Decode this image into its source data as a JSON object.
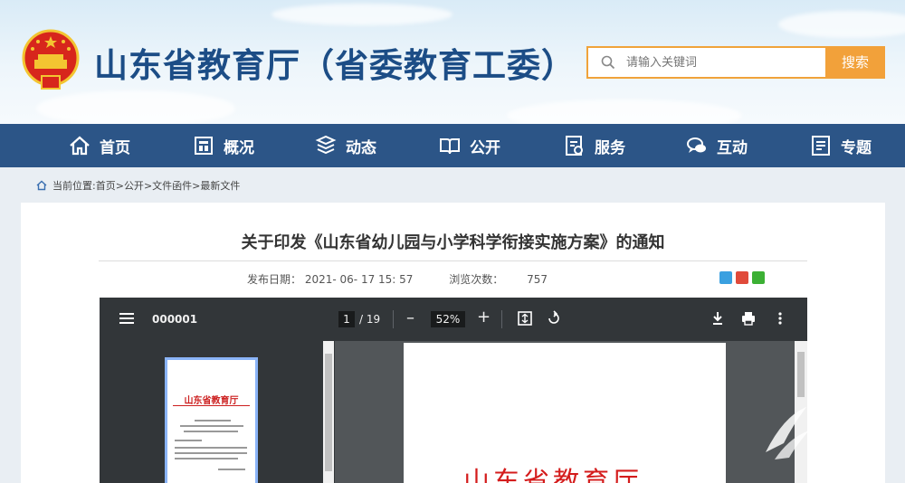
{
  "header": {
    "title": "山东省教育厅（省委教育工委）",
    "search_placeholder": "请输入关键词",
    "search_button": "搜索"
  },
  "nav": {
    "items": [
      {
        "label": "首页",
        "icon": "home-icon"
      },
      {
        "label": "概况",
        "icon": "overview-icon"
      },
      {
        "label": "动态",
        "icon": "news-icon"
      },
      {
        "label": "公开",
        "icon": "book-icon"
      },
      {
        "label": "服务",
        "icon": "service-icon"
      },
      {
        "label": "互动",
        "icon": "chat-icon"
      },
      {
        "label": "专题",
        "icon": "topic-icon"
      }
    ]
  },
  "breadcrumb": {
    "prefix": "当前位置:",
    "items": [
      "首页",
      "公开",
      "文件函件",
      "最新文件"
    ],
    "separator": ">"
  },
  "article": {
    "title": "关于印发《山东省幼儿园与小学科学衔接实施方案》的通知",
    "date_label": "发布日期：",
    "date": "2021- 06- 17 15: 57",
    "views_label": "浏览次数：",
    "views": "757"
  },
  "viewer": {
    "filename": "000001",
    "current_page": "1",
    "total_pages": "/ 19",
    "zoom": "52%",
    "minus": "–",
    "plus": "+",
    "thumb_title": "山东省教育厅",
    "page_title": "山东省教育厅"
  },
  "colors": {
    "nav_bg": "#2c5587",
    "title_blue": "#1c4d86",
    "accent_orange": "#f2a13a",
    "doc_red": "#d41c1c"
  }
}
